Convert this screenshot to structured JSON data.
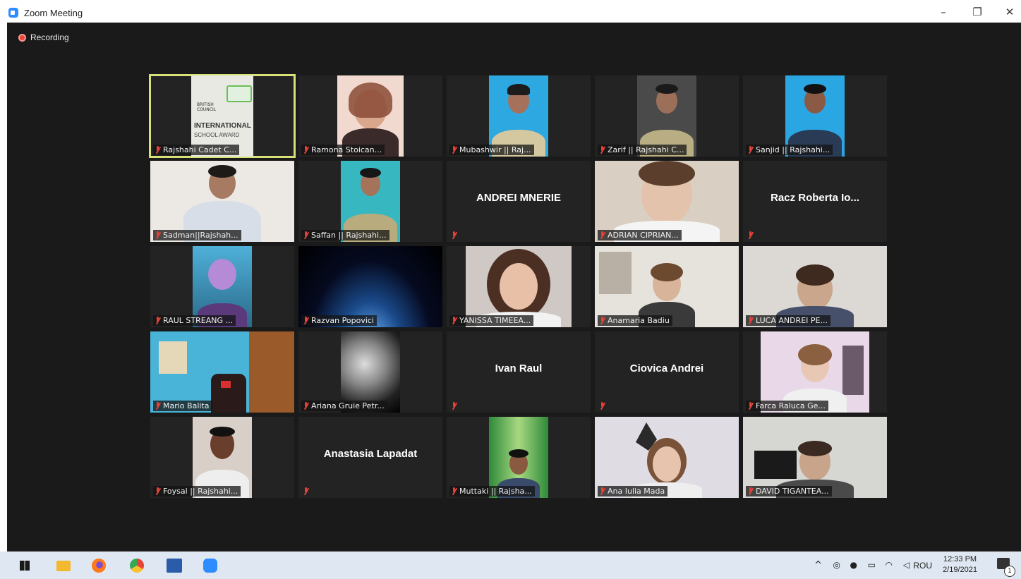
{
  "window": {
    "title": "Zoom Meeting",
    "minimize_icon": "–",
    "restore_icon": "❐",
    "close_icon": "✕"
  },
  "meeting": {
    "recording_label": "Recording",
    "participants": [
      {
        "name": "Rajshahi Cadet C...",
        "display": "video",
        "active": true
      },
      {
        "name": "Ramona Stoican...",
        "display": "video"
      },
      {
        "name": "Mubashwir || Raj...",
        "display": "video"
      },
      {
        "name": "Zarif || Rajshahi C...",
        "display": "video"
      },
      {
        "name": "Sanjid || Rajshahi...",
        "display": "video"
      },
      {
        "name": "Sadman||Rajshah...",
        "display": "video"
      },
      {
        "name": "Saffan || Rajshahi...",
        "display": "video"
      },
      {
        "name": "ANDREI MNERIE",
        "display": "name"
      },
      {
        "name": "ADRIAN CIPRIAN...",
        "display": "video"
      },
      {
        "name": "Racz Roberta Io...",
        "display": "name"
      },
      {
        "name": "RAUL STREANG ...",
        "display": "video"
      },
      {
        "name": "Razvan Popovici",
        "display": "video"
      },
      {
        "name": "YANISSA TIMEEA...",
        "display": "video"
      },
      {
        "name": "Anamaria Badiu",
        "display": "video"
      },
      {
        "name": "LUCA ANDREI PE...",
        "display": "video"
      },
      {
        "name": "Mario Balita",
        "display": "video"
      },
      {
        "name": "Ariana Gruie Petr...",
        "display": "video"
      },
      {
        "name": "Ivan Raul",
        "display": "name"
      },
      {
        "name": "Ciovica Andrei",
        "display": "name"
      },
      {
        "name": "Farca Raluca Ge...",
        "display": "video"
      },
      {
        "name": "Foysal || Rajshahi...",
        "display": "video"
      },
      {
        "name": "Anastasia Lapadat",
        "display": "name"
      },
      {
        "name": "Muttaki || Rajsha...",
        "display": "video"
      },
      {
        "name": "Ana Iulia Mada",
        "display": "video"
      },
      {
        "name": "DAVID TIGANTEA...",
        "display": "video"
      }
    ],
    "award_card": {
      "line1": "BRITISH",
      "line2": "COUNCIL",
      "line3": "INTERNATIONAL",
      "line4": "SCHOOL AWARD"
    }
  },
  "taskbar": {
    "tray_language": "ROU",
    "time": "12:33 PM",
    "date": "2/19/2021",
    "notification_count": "1"
  }
}
